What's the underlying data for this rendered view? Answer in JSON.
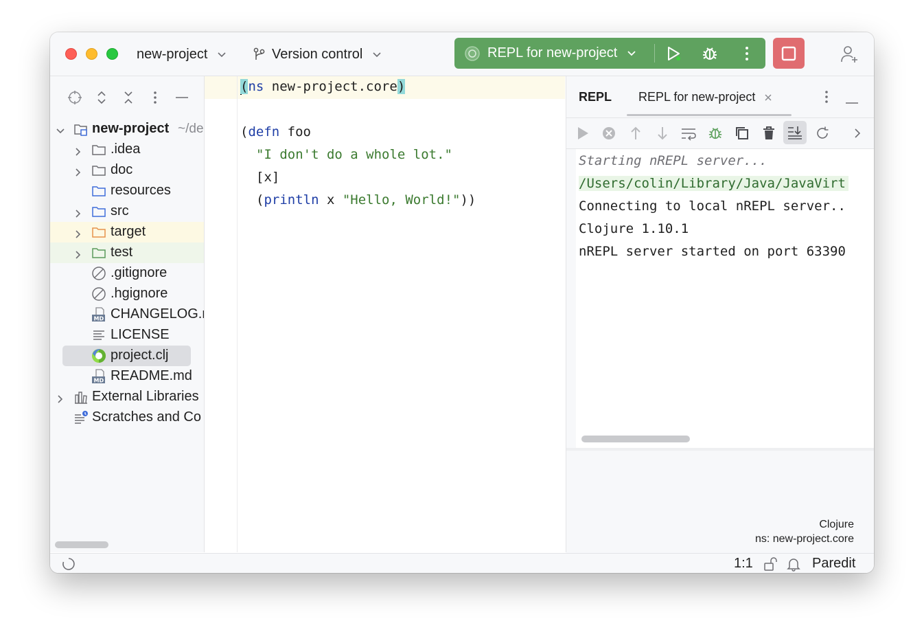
{
  "titlebar": {
    "project_name": "new-project",
    "vcs_label": "Version control",
    "run_config": "REPL for new-project"
  },
  "project_tree": {
    "root_label": "new-project",
    "root_path": "~/de",
    "items": [
      {
        "label": ".idea",
        "icon": "folder-icon"
      },
      {
        "label": "doc",
        "icon": "folder-icon"
      },
      {
        "label": "resources",
        "icon": "folder-icon"
      },
      {
        "label": "src",
        "icon": "folder-icon"
      },
      {
        "label": "target",
        "icon": "folder-icon"
      },
      {
        "label": "test",
        "icon": "folder-icon"
      },
      {
        "label": ".gitignore",
        "icon": "ignore-file-icon"
      },
      {
        "label": ".hgignore",
        "icon": "ignore-file-icon"
      },
      {
        "label": "CHANGELOG.r",
        "icon": "markdown-icon"
      },
      {
        "label": "LICENSE",
        "icon": "text-file-icon"
      },
      {
        "label": "project.clj",
        "icon": "clojure-icon"
      },
      {
        "label": "README.md",
        "icon": "markdown-icon"
      }
    ],
    "external_libraries": "External Libraries",
    "scratches": "Scratches and Co"
  },
  "editor": {
    "line1_kw": "ns",
    "line1_rest": " new-project.core",
    "line3_open": "(",
    "line3_kw": "defn",
    "line3_rest": " foo",
    "line4_str": "\"I don't do a whole lot.\"",
    "line5": "[x]",
    "line6_kw": "println",
    "line6_mid": " x ",
    "line6_str": "\"Hello, World!\"",
    "line6_close": "))"
  },
  "repl_panel": {
    "title": "REPL",
    "tab_label": "REPL for new-project",
    "console_lines": [
      "Starting nREPL server...",
      "/Users/colin/Library/Java/JavaVirt",
      "Connecting to local nREPL server..",
      "Clojure 1.10.1",
      "nREPL server started on port 63390"
    ],
    "language": "Clojure",
    "namespace": "ns: new-project.core"
  },
  "statusbar": {
    "position": "1:1",
    "mode": "Paredit"
  },
  "colors": {
    "run_group": "#5fa25f",
    "stop_button": "#e06c70",
    "keyword": "#1f3ea6",
    "string": "#3b7a2f",
    "folder_blue": "#3f6cd9",
    "folder_orange": "#e6924a",
    "folder_green": "#5a9a5a"
  }
}
